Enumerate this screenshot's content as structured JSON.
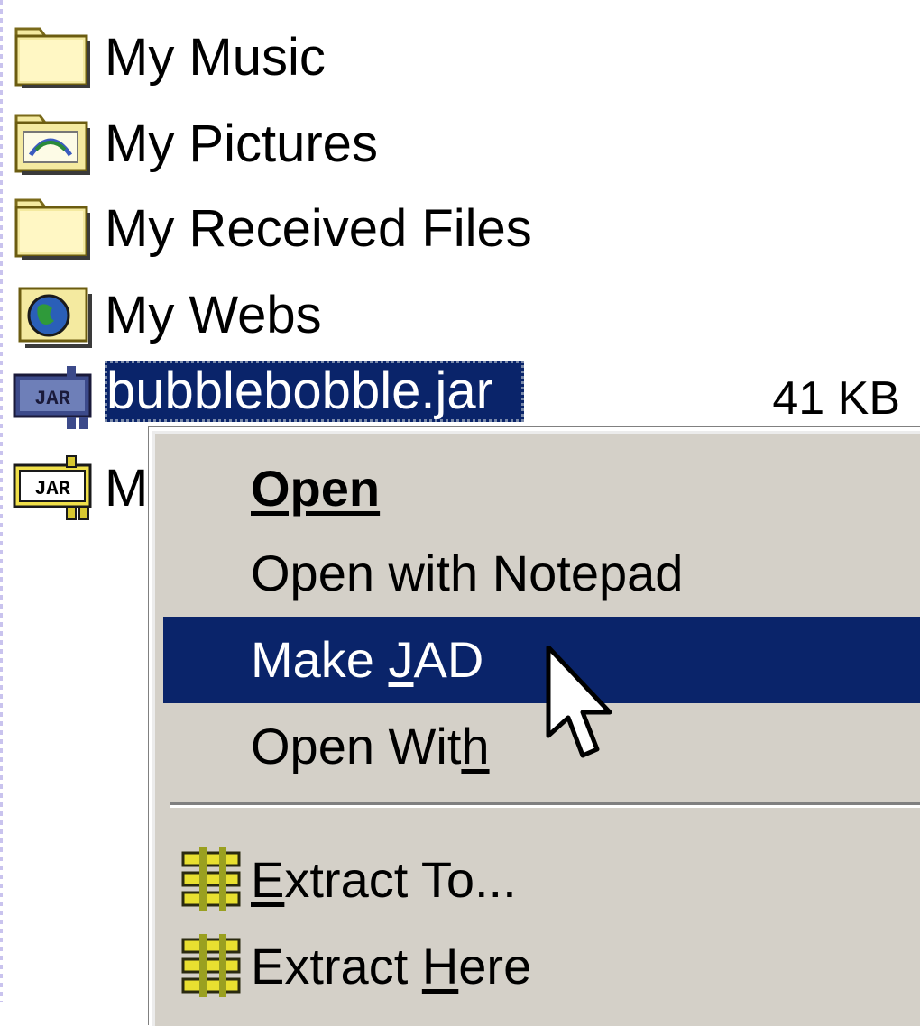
{
  "files": [
    {
      "name": "My Music",
      "size": "",
      "icon": "folder-icon"
    },
    {
      "name": "My Pictures",
      "size": "",
      "icon": "pictures-folder-icon"
    },
    {
      "name": "My Received Files",
      "size": "",
      "icon": "folder-icon"
    },
    {
      "name": "My Webs",
      "size": "",
      "icon": "webs-folder-icon"
    },
    {
      "name": "bubblebobble.jar",
      "size": "41 KB",
      "icon": "jar-file-icon",
      "selected": true
    },
    {
      "name": "M",
      "size": "",
      "icon": "jar-file-icon"
    }
  ],
  "context_menu": {
    "items": [
      {
        "pre": "",
        "u": "Open",
        "post": "",
        "bold": true
      },
      {
        "pre": "Open with Notepad",
        "u": "",
        "post": ""
      },
      {
        "pre": "Make ",
        "u": "J",
        "post": "AD",
        "highlighted": true
      },
      {
        "pre": "Open Wit",
        "u": "h",
        "post": ""
      },
      {
        "pre": "",
        "u": "E",
        "post": "xtract To...",
        "icon": "archive-extract-icon"
      },
      {
        "pre": "Extract ",
        "u": "H",
        "post": "ere",
        "icon": "archive-extract-icon"
      }
    ]
  },
  "colors": {
    "selection": "#0a246a",
    "menu_background": "#d4d0c8",
    "folder_yellow": "#f4eaa0"
  }
}
